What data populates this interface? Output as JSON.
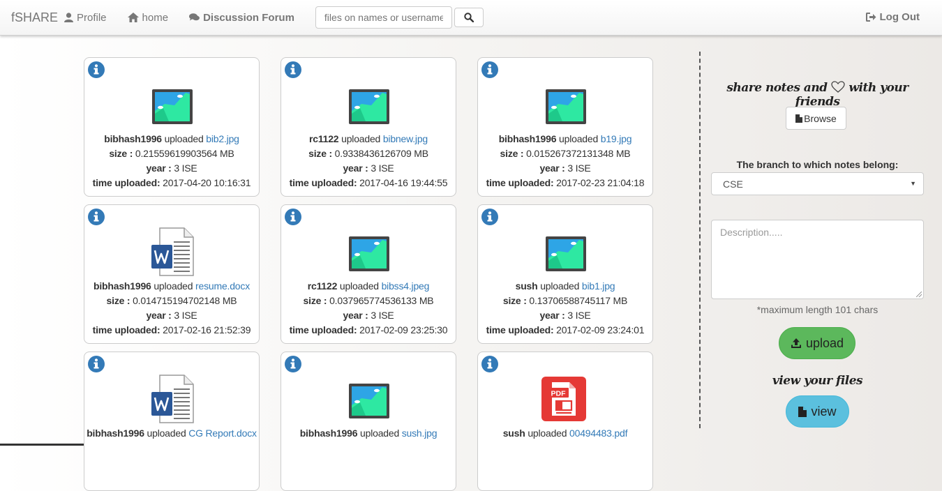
{
  "navbar": {
    "brand": "fSHARE",
    "profile_label": "Profile",
    "home_label": "home",
    "forum_label": "Discussion Forum",
    "search_placeholder": "files on names or usernames",
    "logout_label": "Log Out"
  },
  "labels": {
    "uploaded": "uploaded",
    "size": "size :",
    "year": "year :",
    "time": "time uploaded:"
  },
  "files": [
    {
      "user": "bibhash1996",
      "file": "bib2.jpg",
      "type": "image",
      "size": "0.21559619903564 MB",
      "year": "3 ISE",
      "time": "2017-04-20 10:16:31"
    },
    {
      "user": "rc1122",
      "file": "bibnew.jpg",
      "type": "image",
      "size": "0.9338436126709 MB",
      "year": "3 ISE",
      "time": "2017-04-16 19:44:55"
    },
    {
      "user": "bibhash1996",
      "file": "b19.jpg",
      "type": "image",
      "size": "0.015267372131348 MB",
      "year": "3 ISE",
      "time": "2017-02-23 21:04:18"
    },
    {
      "user": "bibhash1996",
      "file": "resume.docx",
      "type": "word",
      "size": "0.014715194702148 MB",
      "year": "3 ISE",
      "time": "2017-02-16 21:52:39"
    },
    {
      "user": "rc1122",
      "file": "bibss4.jpeg",
      "type": "image",
      "size": "0.037965774536133 MB",
      "year": "3 ISE",
      "time": "2017-02-09 23:25:30"
    },
    {
      "user": "sush",
      "file": "bib1.jpg",
      "type": "image",
      "size": "0.13706588745117 MB",
      "year": "3 ISE",
      "time": "2017-02-09 23:24:01"
    },
    {
      "user": "bibhash1996",
      "file": "CG Report.docx",
      "type": "word"
    },
    {
      "user": "bibhash1996",
      "file": "sush.jpg",
      "type": "image"
    },
    {
      "user": "sush",
      "file": "00494483.pdf",
      "type": "pdf"
    }
  ],
  "sidebar": {
    "tagline_before": "share notes and",
    "tagline_after": "with your friends",
    "browse_label": "Browse",
    "branch_label": "The branch to which notes belong:",
    "branch_value": "CSE",
    "description_placeholder": "Description.....",
    "max_length_note": "*maximum length 101 chars",
    "upload_label": "upload",
    "view_files_title": "view your files",
    "view_label": "view"
  },
  "colors": {
    "link": "#337ab7",
    "info_icon": "#337ab7",
    "upload_button": "#5cb85c",
    "view_button": "#5bc0de"
  }
}
